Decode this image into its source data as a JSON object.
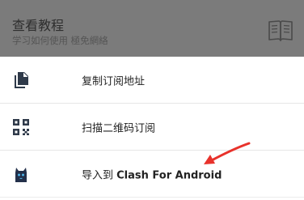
{
  "header": {
    "title": "查看教程",
    "subtitle": "学习如何使用 極免網絡",
    "icon": "book-icon"
  },
  "menu": {
    "items": [
      {
        "icon": "copy-icon",
        "label": "复制订阅地址"
      },
      {
        "icon": "qr-code-icon",
        "label": "扫描二维码订阅"
      },
      {
        "icon": "cat-icon",
        "label_prefix": "导入到 ",
        "label_bold": "Clash For Android"
      }
    ]
  },
  "colors": {
    "header_bg": "#7b7b7b",
    "accent_arrow": "#e8322b",
    "icon_dark": "#2f3a4a"
  }
}
